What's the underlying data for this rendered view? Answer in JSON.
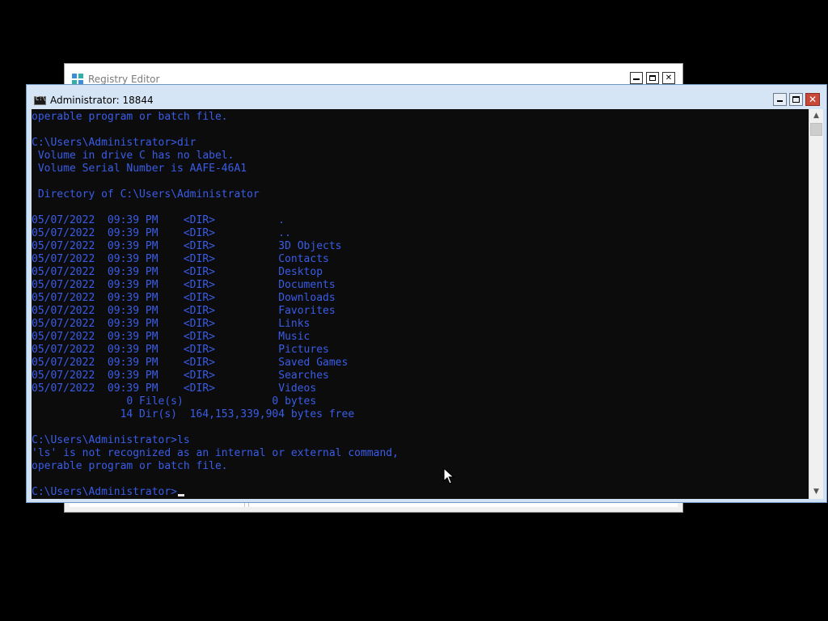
{
  "background_window": {
    "title": "Registry Editor",
    "icon": "registry-icon",
    "controls": [
      "minimize",
      "maximize",
      "close"
    ]
  },
  "console": {
    "title": "Administrator:  18844",
    "icon": "cmd-icon",
    "colors": {
      "text": "#3a5de8",
      "background": "#0c0c0c",
      "titlebar": "#d5e5f5",
      "close_button": "#c8483a"
    },
    "lines": [
      "operable program or batch file.",
      "",
      "C:\\Users\\Administrator>dir",
      " Volume in drive C has no label.",
      " Volume Serial Number is AAFE-46A1",
      "",
      " Directory of C:\\Users\\Administrator",
      "",
      "05/07/2022  09:39 PM    <DIR>          .",
      "05/07/2022  09:39 PM    <DIR>          ..",
      "05/07/2022  09:39 PM    <DIR>          3D Objects",
      "05/07/2022  09:39 PM    <DIR>          Contacts",
      "05/07/2022  09:39 PM    <DIR>          Desktop",
      "05/07/2022  09:39 PM    <DIR>          Documents",
      "05/07/2022  09:39 PM    <DIR>          Downloads",
      "05/07/2022  09:39 PM    <DIR>          Favorites",
      "05/07/2022  09:39 PM    <DIR>          Links",
      "05/07/2022  09:39 PM    <DIR>          Music",
      "05/07/2022  09:39 PM    <DIR>          Pictures",
      "05/07/2022  09:39 PM    <DIR>          Saved Games",
      "05/07/2022  09:39 PM    <DIR>          Searches",
      "05/07/2022  09:39 PM    <DIR>          Videos",
      "               0 File(s)              0 bytes",
      "              14 Dir(s)  164,153,339,904 bytes free",
      "",
      "C:\\Users\\Administrator>ls",
      "'ls' is not recognized as an internal or external command,",
      "operable program or batch file.",
      ""
    ],
    "prompt": "C:\\Users\\Administrator>"
  }
}
